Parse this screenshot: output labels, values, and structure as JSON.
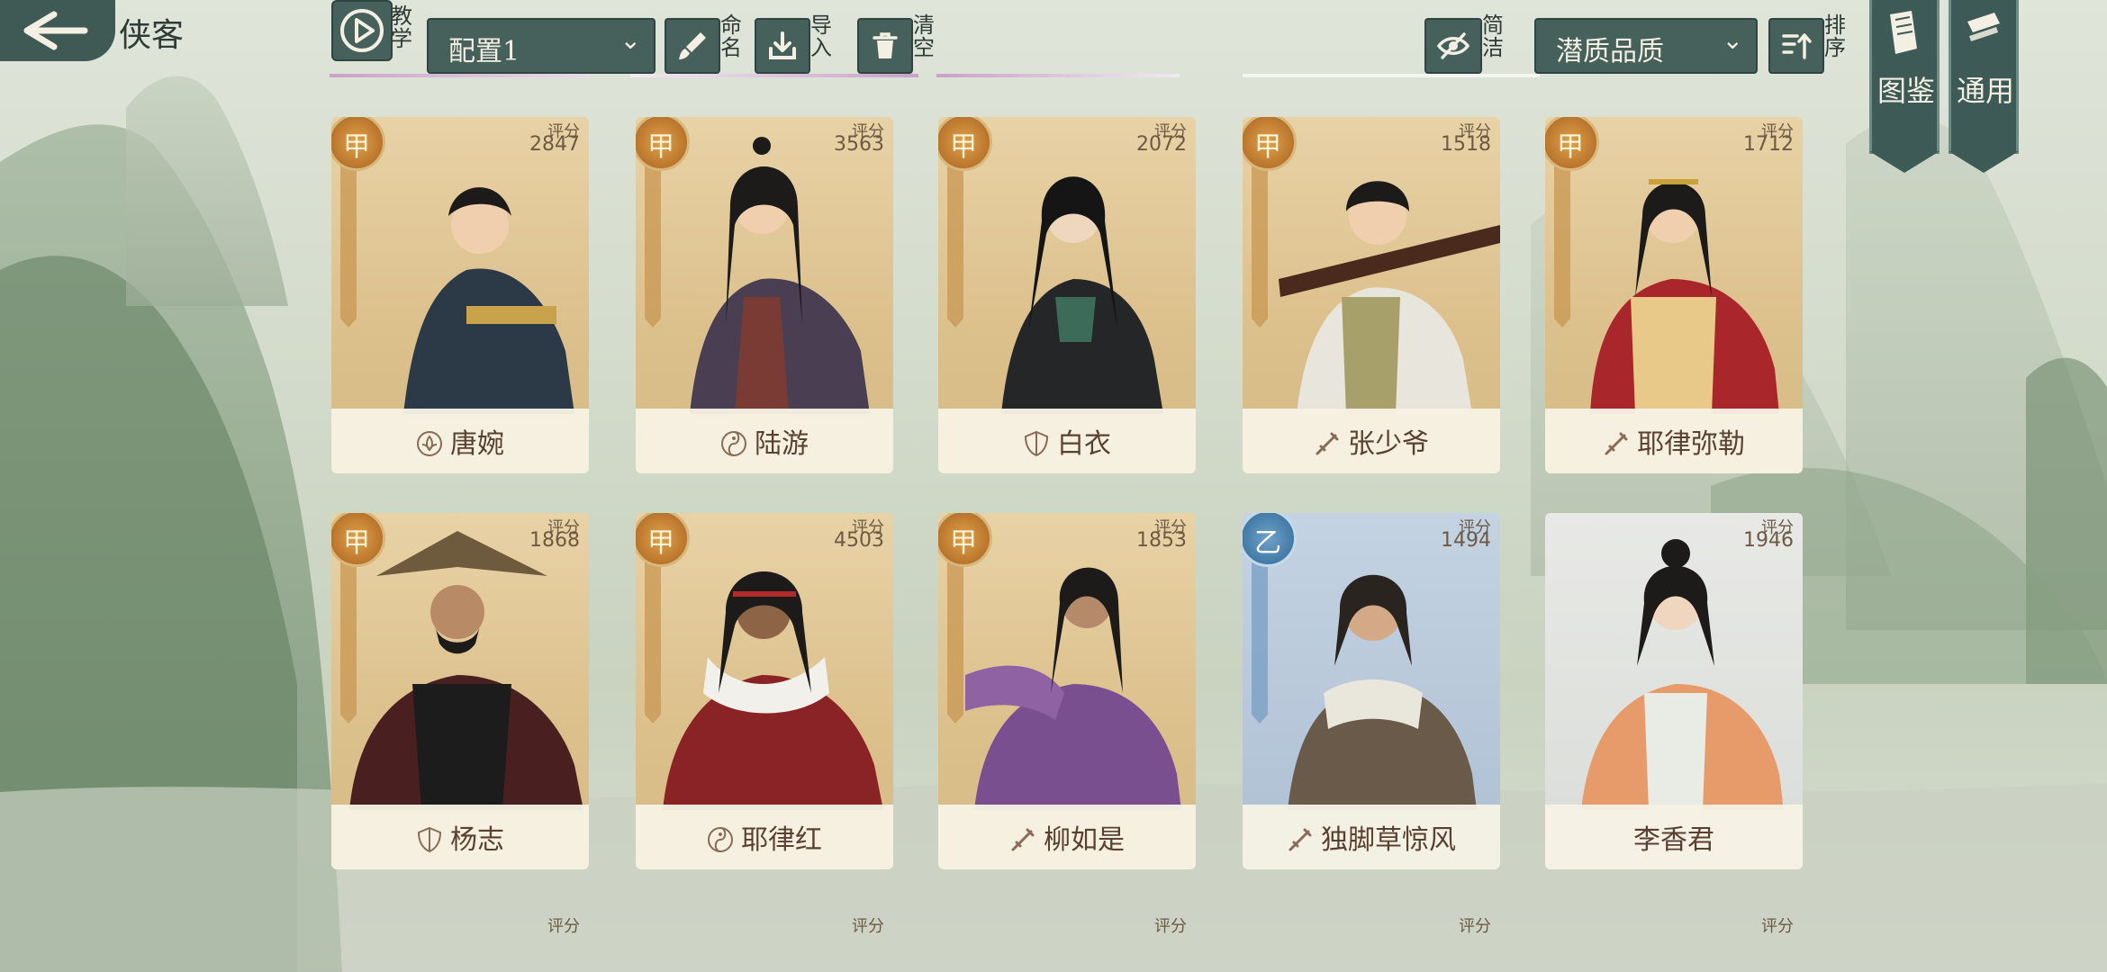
{
  "header": {
    "title": "侠客",
    "teach_label": "教学",
    "config_select": "配置1",
    "rename_label": "命名",
    "import_label": "导入",
    "clear_label": "清空",
    "simple_label": "简洁",
    "sort_select": "潜质品质",
    "sort_label": "排序",
    "codex_label": "图鉴",
    "common_label": "通用"
  },
  "cards": [
    {
      "name": "唐婉",
      "score_label": "评分",
      "score": "2847",
      "grade": "甲",
      "tier": "gold",
      "faction_icon": "lotus-icon"
    },
    {
      "name": "陆游",
      "score_label": "评分",
      "score": "3563",
      "grade": "甲",
      "tier": "gold",
      "faction_icon": "yin-yang-icon"
    },
    {
      "name": "白衣",
      "score_label": "评分",
      "score": "2072",
      "grade": "甲",
      "tier": "gold",
      "faction_icon": "shield-icon"
    },
    {
      "name": "张少爷",
      "score_label": "评分",
      "score": "1518",
      "grade": "甲",
      "tier": "gold",
      "faction_icon": "sword-icon"
    },
    {
      "name": "耶律弥勒",
      "score_label": "评分",
      "score": "1712",
      "grade": "甲",
      "tier": "gold",
      "faction_icon": "sword-icon"
    },
    {
      "name": "杨志",
      "score_label": "评分",
      "score": "1868",
      "grade": "甲",
      "tier": "gold",
      "faction_icon": "shield-icon"
    },
    {
      "name": "耶律红",
      "score_label": "评分",
      "score": "4503",
      "grade": "甲",
      "tier": "gold",
      "faction_icon": "yin-yang-icon"
    },
    {
      "name": "柳如是",
      "score_label": "评分",
      "score": "1853",
      "grade": "甲",
      "tier": "gold",
      "faction_icon": "sword-icon"
    },
    {
      "name": "独脚草惊风",
      "score_label": "评分",
      "score": "1494",
      "grade": "乙",
      "tier": "blue",
      "faction_icon": "sword-icon"
    },
    {
      "name": "李香君",
      "score_label": "评分",
      "score": "1946",
      "grade": "",
      "tier": "white",
      "faction_icon": ""
    }
  ],
  "peek_row": {
    "score_label": "评分"
  },
  "colors": {
    "button": "#46605b",
    "gold_card": "#dcc08c",
    "blue_card": "#aebfd3",
    "white_card": "#d9dcd8",
    "text": "#5a4030"
  }
}
